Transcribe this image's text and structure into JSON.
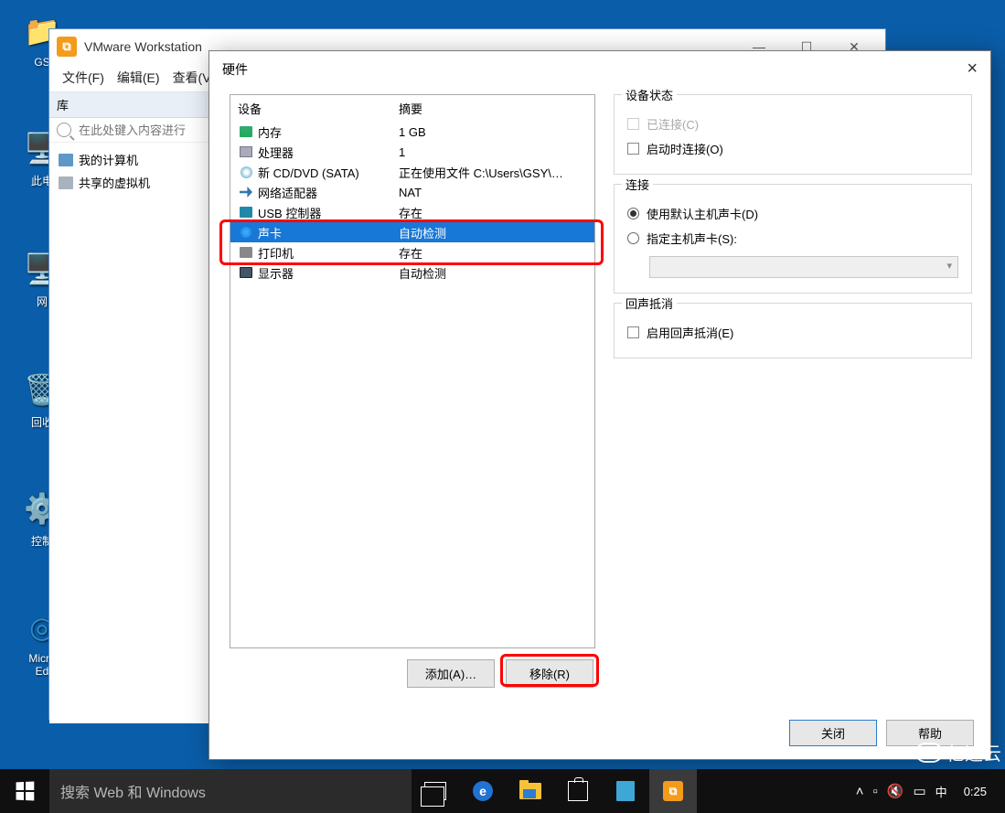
{
  "desktop": {
    "icons": [
      {
        "label": "GS"
      },
      {
        "label": "此电"
      },
      {
        "label": "网"
      },
      {
        "label": "回收"
      },
      {
        "label": "控制"
      },
      {
        "label": "Micro\nEd"
      }
    ]
  },
  "vmware": {
    "title": "VMware Workstation",
    "menu": [
      "文件(F)",
      "编辑(E)",
      "查看(V"
    ],
    "library_title": "库",
    "search_placeholder": "在此处键入内容进行",
    "tree": {
      "my_computer": "我的计算机",
      "shared_vms": "共享的虚拟机"
    }
  },
  "hw": {
    "title": "硬件",
    "col_device": "设备",
    "col_summary": "摘要",
    "rows": [
      {
        "icon": "mem",
        "dev": "内存",
        "sum": "1 GB"
      },
      {
        "icon": "cpu",
        "dev": "处理器",
        "sum": "1"
      },
      {
        "icon": "cd",
        "dev": "新 CD/DVD (SATA)",
        "sum": "正在使用文件 C:\\Users\\GSY\\…"
      },
      {
        "icon": "net",
        "dev": "网络适配器",
        "sum": "NAT"
      },
      {
        "icon": "usb",
        "dev": "USB 控制器",
        "sum": "存在"
      },
      {
        "icon": "snd",
        "dev": "声卡",
        "sum": "自动检测",
        "selected": true
      },
      {
        "icon": "prn",
        "dev": "打印机",
        "sum": "存在"
      },
      {
        "icon": "disp",
        "dev": "显示器",
        "sum": "自动检测"
      }
    ],
    "add_btn": "添加(A)…",
    "remove_btn": "移除(R)",
    "right": {
      "status_legend": "设备状态",
      "connected": "已连接(C)",
      "connect_at_poweron": "启动时连接(O)",
      "connection_legend": "连接",
      "use_default": "使用默认主机声卡(D)",
      "specify": "指定主机声卡(S):",
      "echo_legend": "回声抵消",
      "echo_enable": "启用回声抵消(E)"
    },
    "close_btn": "关闭",
    "help_btn": "帮助"
  },
  "taskbar": {
    "search_placeholder": "搜索 Web 和 Windows",
    "ime": "中",
    "time": "0:25"
  },
  "watermark": "亿速云"
}
